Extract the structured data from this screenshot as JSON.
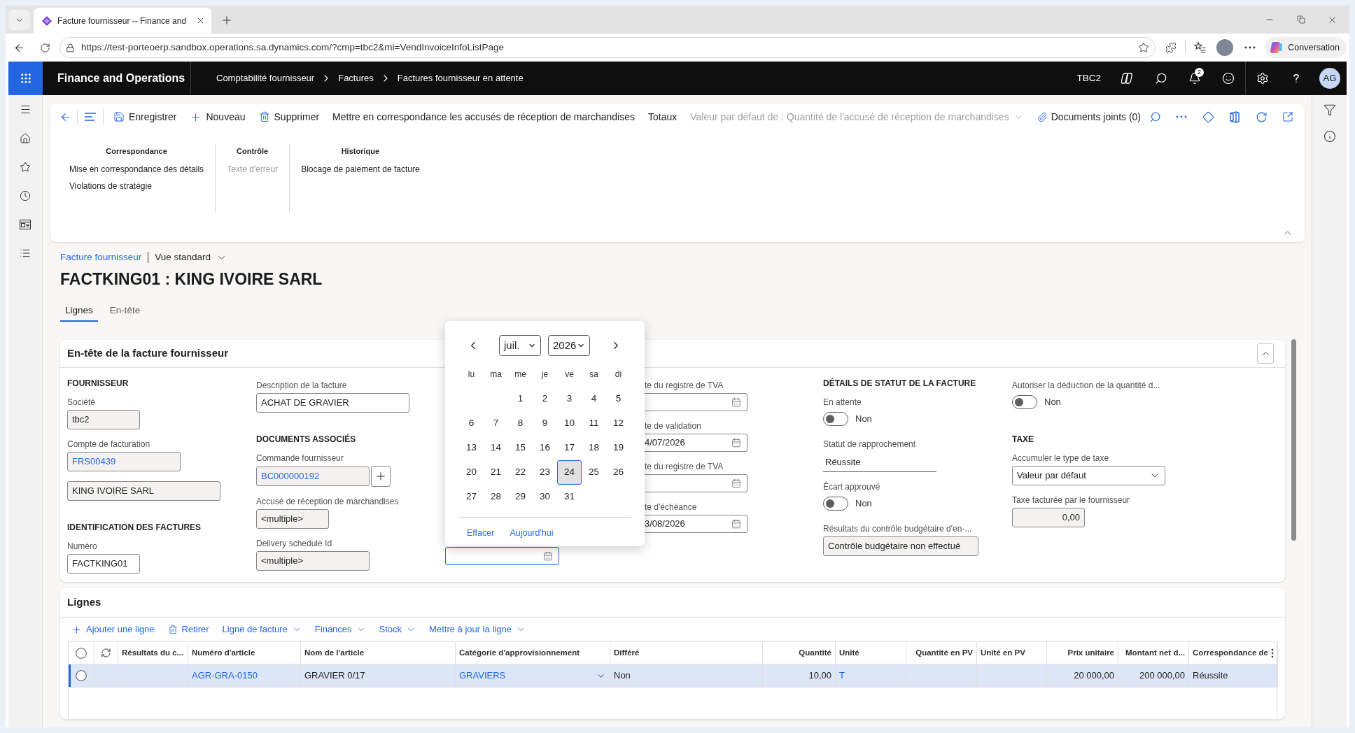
{
  "browser": {
    "tab_title": "Facture fournisseur -- Finance and",
    "url": "https://test-porteoerp.sandbox.operations.sa.dynamics.com/?cmp=tbc2&mi=VendInvoiceInfoListPage",
    "assistant_button": "Conversation"
  },
  "app_bar": {
    "title": "Finance and Operations",
    "breadcrumb": [
      "Comptabilité fournisseur",
      "Factures",
      "Factures fournisseur en attente"
    ],
    "company": "TBC2",
    "notification_count": "2",
    "user_initials": "AG"
  },
  "action_pane": {
    "expanded": true,
    "buttons": [
      {
        "kind": "save",
        "label": "Enregistrer"
      },
      {
        "kind": "new",
        "label": "Nouveau"
      },
      {
        "kind": "delete",
        "label": "Supprimer"
      },
      {
        "kind": "text",
        "label": "Mettre en correspondance les accusés de réception de marchandises"
      },
      {
        "kind": "text",
        "label": "Totaux"
      }
    ],
    "default_menu": {
      "label": "Valeur par défaut de : Quantité de l'accusé de réception de marchandises",
      "disabled": true
    },
    "attachments": "Documents joints (0)",
    "groups": [
      {
        "title": "Correspondance",
        "items": [
          {
            "label": "Mise en correspondance des détails",
            "disabled": false
          },
          {
            "label": "Violations de stratégie",
            "disabled": false
          }
        ]
      },
      {
        "title": "Contrôle",
        "items": [
          {
            "label": "Texte d'erreur",
            "disabled": true
          }
        ]
      },
      {
        "title": "Historique",
        "items": [
          {
            "label": "Blocage de paiement de facture",
            "disabled": false
          }
        ]
      }
    ]
  },
  "page": {
    "form_link": "Facture fournisseur",
    "view": "Vue standard",
    "title": "FACTKING01 : KING IVOIRE SARL",
    "tabs": [
      {
        "label": "Lignes",
        "selected": true
      },
      {
        "label": "En-tête",
        "selected": false
      }
    ]
  },
  "header_section": {
    "title": "En-tête de la facture fournisseur",
    "expanded": true,
    "columns": [
      {
        "items": [
          {
            "kind": "heading",
            "text": "FOURNISSEUR"
          },
          {
            "kind": "field",
            "label": "Société",
            "value": "tbc2",
            "readonly": true,
            "link": false
          },
          {
            "kind": "field",
            "label": "Compte de facturation",
            "value": "FRS00439",
            "readonly": true,
            "link": true
          },
          {
            "kind": "field",
            "value": "KING IVOIRE SARL",
            "readonly": true,
            "link": false
          },
          {
            "kind": "heading",
            "text": "IDENTIFICATION DES FACTURES"
          },
          {
            "kind": "field",
            "label": "Numéro",
            "value": "FACTKING01",
            "readonly": false,
            "link": false
          }
        ]
      },
      {
        "items": [
          {
            "kind": "field",
            "label": "Description de la facture",
            "value": "ACHAT DE GRAVIER",
            "readonly": false,
            "link": false
          },
          {
            "kind": "heading",
            "text": "DOCUMENTS ASSOCIÉS"
          },
          {
            "kind": "lookup_add",
            "label": "Commande fournisseur",
            "value": "BC000000192",
            "readonly": true,
            "link": true
          },
          {
            "kind": "field",
            "label": "Accusé de réception de marchandises",
            "value": "<multiple>",
            "readonly": true,
            "link": false
          },
          {
            "kind": "field",
            "label": "Delivery schedule Id",
            "value": "<multiple>",
            "readonly": true,
            "link": false
          }
        ]
      },
      {
        "items": [
          {
            "kind": "date",
            "focused": true
          }
        ]
      },
      {
        "items": [
          {
            "kind": "date",
            "label": "te du registre de TVA",
            "focused": false
          },
          {
            "kind": "date",
            "label": "te de validation",
            "value": "4/07/2026",
            "focused": false
          },
          {
            "kind": "date",
            "label": "te du registre de TVA",
            "focused": false
          },
          {
            "kind": "date",
            "label": "te d'échéance",
            "value": "3/08/2026",
            "focused": false
          }
        ]
      },
      {
        "items": [
          {
            "kind": "heading",
            "text": "DÉTAILS DE STATUT DE LA FACTURE"
          },
          {
            "kind": "toggle",
            "label": "En attente",
            "on": false,
            "value": "Non"
          },
          {
            "kind": "static",
            "label": "Statut de rapprochement",
            "value": "Réussite"
          },
          {
            "kind": "toggle",
            "label": "Écart approuvé",
            "on": false,
            "value": "Non"
          },
          {
            "kind": "field",
            "label": "Résultats du contrôle budgétaire d'en-...",
            "value": "Contrôle budgétaire non effectué",
            "readonly": true,
            "link": false
          }
        ]
      },
      {
        "items": [
          {
            "kind": "toggle",
            "label": "Autoriser la déduction de la quantité d...",
            "on": false,
            "value": "Non"
          },
          {
            "kind": "heading",
            "text": "TAXE"
          },
          {
            "kind": "select",
            "label": "Accumuler le type de taxe",
            "value": "Valeur par défaut"
          },
          {
            "kind": "amount",
            "label": "Taxe facturée par le fournisseur",
            "value": "0,00",
            "readonly": true,
            "link": false
          }
        ]
      }
    ]
  },
  "calendar": {
    "month": "juil.",
    "year": "2026",
    "weekdays": [
      "lu",
      "ma",
      "me",
      "je",
      "ve",
      "sa",
      "di"
    ],
    "weeks": [
      {
        "days": [
          {
            "label": "1",
            "selected": false
          },
          {
            "label": "2",
            "selected": false
          },
          {
            "label": "3",
            "selected": false
          },
          {
            "label": "4",
            "selected": false
          },
          {
            "label": "5",
            "selected": false
          }
        ]
      },
      {
        "days": [
          {
            "label": "6",
            "selected": false
          },
          {
            "label": "7",
            "selected": false
          },
          {
            "label": "8",
            "selected": false
          },
          {
            "label": "9",
            "selected": false
          },
          {
            "label": "10",
            "selected": false
          },
          {
            "label": "11",
            "selected": false
          },
          {
            "label": "12",
            "selected": false
          }
        ]
      },
      {
        "days": [
          {
            "label": "13",
            "selected": false
          },
          {
            "label": "14",
            "selected": false
          },
          {
            "label": "15",
            "selected": false
          },
          {
            "label": "16",
            "selected": false
          },
          {
            "label": "17",
            "selected": false
          },
          {
            "label": "18",
            "selected": false
          },
          {
            "label": "19",
            "selected": false
          }
        ]
      },
      {
        "days": [
          {
            "label": "20",
            "selected": false
          },
          {
            "label": "21",
            "selected": false
          },
          {
            "label": "22",
            "selected": false
          },
          {
            "label": "23",
            "selected": false
          },
          {
            "label": "24",
            "selected": true
          },
          {
            "label": "25",
            "selected": false
          },
          {
            "label": "26",
            "selected": false
          }
        ]
      },
      {
        "days": [
          {
            "label": "27",
            "selected": false
          },
          {
            "label": "28",
            "selected": false
          },
          {
            "label": "29",
            "selected": false
          },
          {
            "label": "30",
            "selected": false
          },
          {
            "label": "31",
            "selected": false
          }
        ]
      }
    ],
    "actions": [
      "Effacer",
      "Aujourd'hui"
    ]
  },
  "lines_section": {
    "title": "Lignes",
    "toolbar": [
      {
        "kind": "add",
        "label": "Ajouter une ligne"
      },
      {
        "kind": "remove",
        "label": "Retirer"
      },
      {
        "kind": "menu",
        "label": "Ligne de facture"
      },
      {
        "kind": "menu",
        "label": "Finances"
      },
      {
        "kind": "menu",
        "label": "Stock"
      },
      {
        "kind": "menu",
        "label": "Mettre à jour la ligne"
      }
    ],
    "grid": {
      "columns": [
        {
          "label": "Résultats du c...",
          "kind": "text"
        },
        {
          "label": "Numéro d'article",
          "kind": "text"
        },
        {
          "label": "Nom de l'article",
          "kind": "text"
        },
        {
          "label": "Catégorie d'approvisionnement",
          "kind": "text"
        },
        {
          "label": "Différé",
          "kind": "text"
        },
        {
          "label": "Quantité",
          "kind": "number"
        },
        {
          "label": "Unité",
          "kind": "text"
        },
        {
          "label": "Quantité en PV",
          "kind": "number"
        },
        {
          "label": "Unité en PV",
          "kind": "text"
        },
        {
          "label": "Prix unitaire",
          "kind": "number"
        },
        {
          "label": "Montant net d...",
          "kind": "number"
        },
        {
          "label": "Correspondance de",
          "kind": "text"
        }
      ],
      "rows": [
        {
          "selected": true,
          "cells": [
            null,
            {
              "kind": "link",
              "text": "AGR-GRA-0150"
            },
            {
              "kind": "text",
              "text": "GRAVIER 0/17"
            },
            {
              "kind": "lookup",
              "text": "GRAVIERS"
            },
            {
              "kind": "text",
              "text": "Non"
            },
            {
              "kind": "text",
              "text": "10,00"
            },
            {
              "kind": "link",
              "text": "T"
            },
            null,
            null,
            {
              "kind": "text",
              "text": "20 000,00"
            },
            {
              "kind": "text",
              "text": "200 000,00"
            },
            {
              "kind": "text",
              "text": "Réussite"
            }
          ]
        }
      ]
    }
  }
}
